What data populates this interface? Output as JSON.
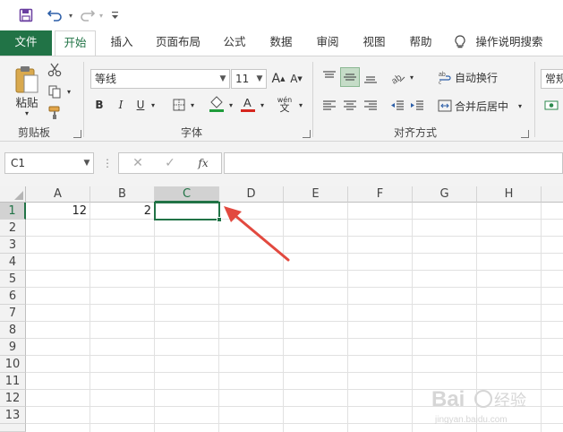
{
  "colors": {
    "accent": "#217346",
    "arrow": "#e2493f"
  },
  "qat": {
    "icons": [
      "save-icon",
      "undo-icon",
      "redo-icon",
      "customize-icon"
    ]
  },
  "tabs": [
    {
      "label": "文件"
    },
    {
      "label": "开始"
    },
    {
      "label": "插入"
    },
    {
      "label": "页面布局"
    },
    {
      "label": "公式"
    },
    {
      "label": "数据"
    },
    {
      "label": "审阅"
    },
    {
      "label": "视图"
    },
    {
      "label": "帮助"
    },
    {
      "label": "操作说明搜索"
    }
  ],
  "ribbon": {
    "clipboard": {
      "paste_label": "粘贴",
      "group_label": "剪贴板"
    },
    "font": {
      "name": "等线",
      "size": "11",
      "group_label": "字体",
      "bold": "B",
      "italic": "I",
      "underline": "U",
      "phonetic": "wén"
    },
    "alignment": {
      "wrap_label": "自动换行",
      "merge_label": "合并后居中",
      "group_label": "对齐方式"
    },
    "number": {
      "format": "常规"
    }
  },
  "formula_bar": {
    "name_box": "C1",
    "fx": "fx",
    "content": ""
  },
  "sheet": {
    "columns": [
      "A",
      "B",
      "C",
      "D",
      "E",
      "F",
      "G",
      "H"
    ],
    "rows": [
      "1",
      "2",
      "3",
      "4",
      "5",
      "6",
      "7",
      "8",
      "9",
      "10",
      "11",
      "12",
      "13"
    ],
    "selected_cell": "C1",
    "cells": {
      "A1": "12",
      "B1": "2"
    }
  }
}
